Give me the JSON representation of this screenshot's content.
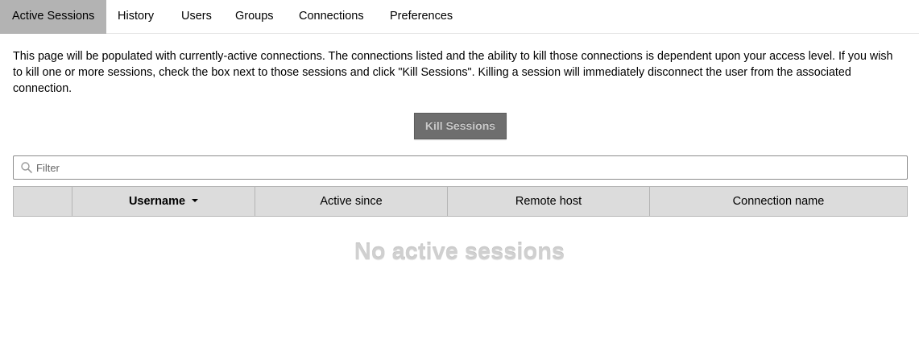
{
  "tabs": [
    {
      "label": "Active Sessions",
      "active": true
    },
    {
      "label": "History",
      "active": false
    },
    {
      "label": "Users",
      "active": false
    },
    {
      "label": "Groups",
      "active": false
    },
    {
      "label": "Connections",
      "active": false
    },
    {
      "label": "Preferences",
      "active": false
    }
  ],
  "description": "This page will be populated with currently-active connections. The connections listed and the ability to kill those connections is dependent upon your access level. If you wish to kill one or more sessions, check the box next to those sessions and click \"Kill Sessions\". Killing a session will immediately disconnect the user from the associated connection.",
  "kill_button": {
    "label": "Kill Sessions",
    "disabled": true
  },
  "filter": {
    "placeholder": "Filter",
    "value": "",
    "icon": "search-icon"
  },
  "table": {
    "columns": [
      {
        "label": ""
      },
      {
        "label": "Username",
        "sorted": true,
        "sort_direction": "descending"
      },
      {
        "label": "Active since"
      },
      {
        "label": "Remote host"
      },
      {
        "label": "Connection name"
      }
    ],
    "rows": []
  },
  "empty_message": "No active sessions",
  "colors": {
    "active_tab_bg": "#b3b3b3",
    "button_bg": "#6e6e6e",
    "button_text": "#c9c9c9",
    "header_bg": "#dcdcdc",
    "empty_text": "#d0d0d0"
  }
}
